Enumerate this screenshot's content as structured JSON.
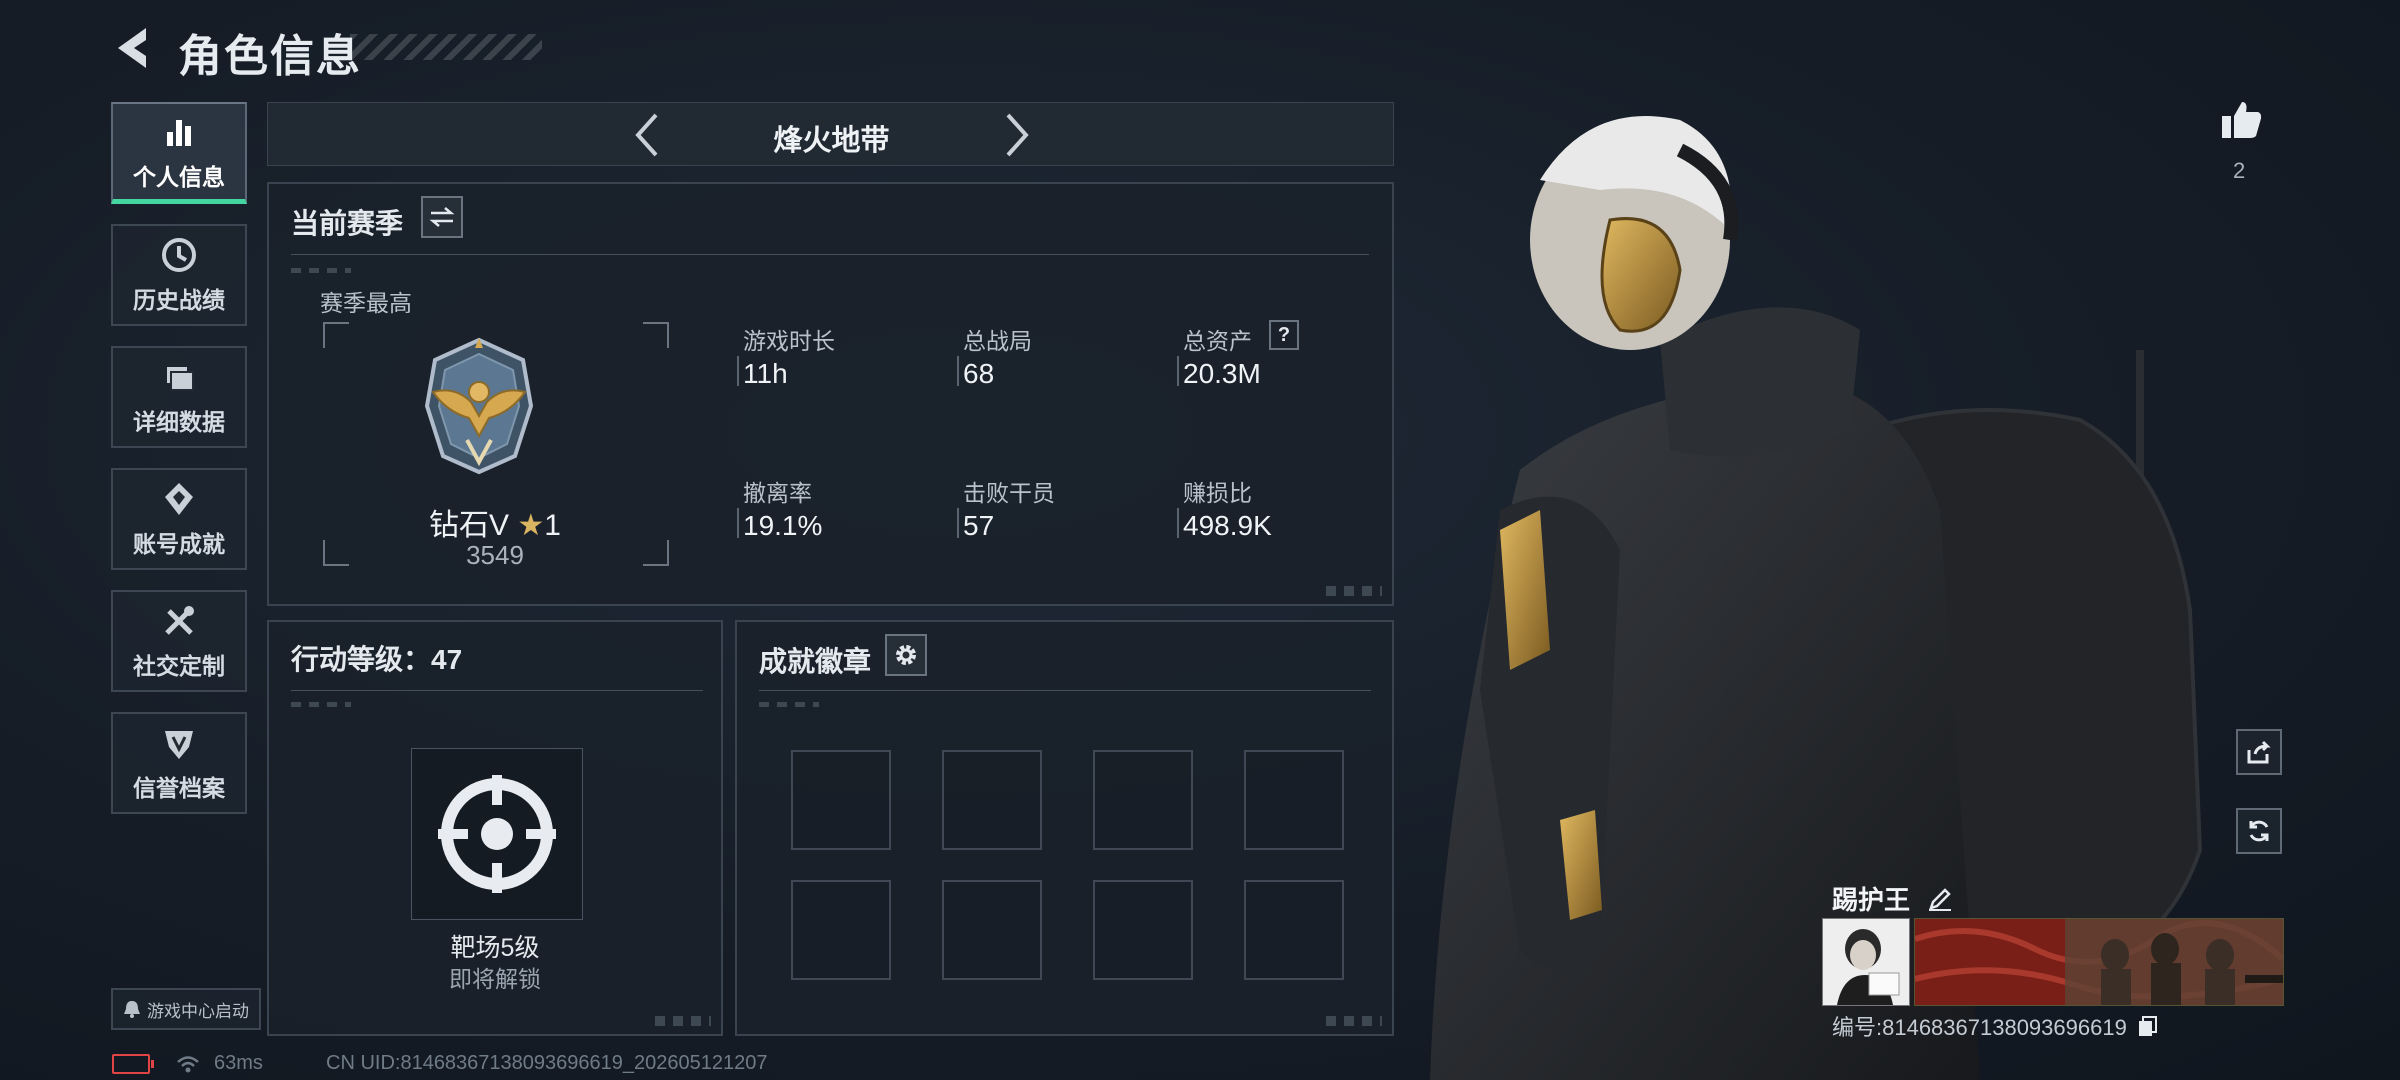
{
  "header": {
    "title": "角色信息"
  },
  "sidebar": {
    "items": [
      {
        "label": "个人信息",
        "active": true,
        "icon": "bar-chart-icon"
      },
      {
        "label": "历史战绩",
        "active": false,
        "icon": "history-clock-icon"
      },
      {
        "label": "详细数据",
        "active": false,
        "icon": "folder-icon"
      },
      {
        "label": "账号成就",
        "active": false,
        "icon": "achievement-icon"
      },
      {
        "label": "社交定制",
        "active": false,
        "icon": "tools-icon"
      },
      {
        "label": "信誉档案",
        "active": false,
        "icon": "shield-emblem-icon"
      }
    ],
    "launch_label": "游戏中心启动"
  },
  "map_selector": {
    "name": "烽火地带"
  },
  "season": {
    "title": "当前赛季",
    "best_label": "赛季最高",
    "rank_name": "钻石V",
    "rank_stars": "1",
    "rank_score": "3549",
    "stats": [
      {
        "label": "游戏时长",
        "value": "11h"
      },
      {
        "label": "总战局",
        "value": "68"
      },
      {
        "label": "总资产",
        "value": "20.3M",
        "help": "?"
      },
      {
        "label": "撤离率",
        "value": "19.1%"
      },
      {
        "label": "击败干员",
        "value": "57"
      },
      {
        "label": "赚损比",
        "value": "498.9K"
      }
    ]
  },
  "action_level": {
    "title": "行动等级：47",
    "target_name": "靶场5级",
    "target_status": "即将解锁"
  },
  "badges": {
    "title": "成就徽章",
    "slots": 8
  },
  "player": {
    "likes": "2",
    "name": "踢护王",
    "id_line": "编号:81468367138093696619"
  },
  "status_bar": {
    "ping": "63ms",
    "uid": "CN UID:81468367138093696619_202605121207"
  },
  "colors": {
    "accent": "#43d6a1",
    "battery": "#e04545"
  }
}
